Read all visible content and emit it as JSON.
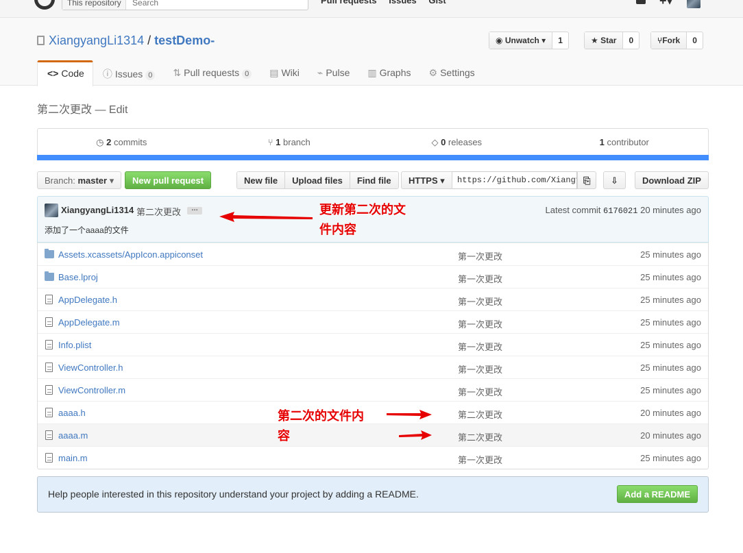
{
  "topbar": {
    "scope": "This repository",
    "search_placeholder": "Search",
    "nav": [
      "Pull requests",
      "Issues",
      "Gist"
    ]
  },
  "repo": {
    "owner": "XiangyangLi1314",
    "separator": "/",
    "name": "testDemo-",
    "unwatch_label": "Unwatch",
    "watch_count": "1",
    "star_label": "Star",
    "star_count": "0",
    "fork_label": "Fork",
    "fork_count": "0"
  },
  "tabs": [
    {
      "label": "Code",
      "icon": "<>"
    },
    {
      "label": "Issues",
      "count": "0"
    },
    {
      "label": "Pull requests",
      "count": "0"
    },
    {
      "label": "Wiki"
    },
    {
      "label": "Pulse"
    },
    {
      "label": "Graphs"
    },
    {
      "label": "Settings"
    }
  ],
  "description": "第二次更改 — Edit",
  "stats": {
    "commits_num": "2",
    "commits_label": "commits",
    "branch_num": "1",
    "branch_label": "branch",
    "releases_num": "0",
    "releases_label": "releases",
    "contrib_num": "1",
    "contrib_label": "contributor"
  },
  "filenav": {
    "branch_prefix": "Branch:",
    "branch_name": "master",
    "new_pr": "New pull request",
    "new_file": "New file",
    "upload": "Upload files",
    "find": "Find file",
    "protocol": "HTTPS",
    "clone_url": "https://github.com/Xiangy",
    "download": "Download ZIP"
  },
  "commit": {
    "author": "XiangyangLi1314",
    "message": "第二次更改",
    "ellipsis": "…",
    "body": "添加了一个aaaa的文件",
    "latest_label": "Latest commit",
    "sha": "6176021",
    "age": "20 minutes ago"
  },
  "files": [
    {
      "name": "Assets.xcassets/AppIcon.appiconset",
      "type": "dir",
      "msg": "第一次更改",
      "age": "25 minutes ago"
    },
    {
      "name": "Base.lproj",
      "type": "dir",
      "msg": "第一次更改",
      "age": "25 minutes ago"
    },
    {
      "name": "AppDelegate.h",
      "type": "file",
      "msg": "第一次更改",
      "age": "25 minutes ago"
    },
    {
      "name": "AppDelegate.m",
      "type": "file",
      "msg": "第一次更改",
      "age": "25 minutes ago"
    },
    {
      "name": "Info.plist",
      "type": "file",
      "msg": "第一次更改",
      "age": "25 minutes ago"
    },
    {
      "name": "ViewController.h",
      "type": "file",
      "msg": "第一次更改",
      "age": "25 minutes ago"
    },
    {
      "name": "ViewController.m",
      "type": "file",
      "msg": "第一次更改",
      "age": "25 minutes ago"
    },
    {
      "name": "aaaa.h",
      "type": "file",
      "msg": "第二次更改",
      "age": "20 minutes ago"
    },
    {
      "name": "aaaa.m",
      "type": "file",
      "msg": "第二次更改",
      "age": "20 minutes ago",
      "highlight": true
    },
    {
      "name": "main.m",
      "type": "file",
      "msg": "第一次更改",
      "age": "25 minutes ago"
    }
  ],
  "readme": {
    "text": "Help people interested in this repository understand your project by adding a README.",
    "button": "Add a README"
  },
  "annotations": {
    "top_line1": "更新第二次的文",
    "top_line2": "件内容",
    "bottom_line1": "第二次的文件内",
    "bottom_line2": "容",
    "color": "#e60000"
  }
}
